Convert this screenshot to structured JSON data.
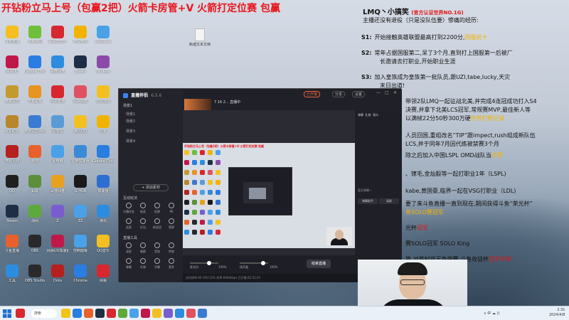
{
  "banner": "开钻粉立马上号（包赢2把）火箭卡房管+V  火箭打定位赛 包赢",
  "desktop_icons": [
    {
      "label": "斗鱼直播",
      "color": "#f4c021"
    },
    {
      "label": "斗鱼伴侣",
      "color": "#6fbf3a"
    },
    {
      "label": "网易云音乐",
      "color": "#d8272f"
    },
    {
      "label": "哔哩哔哩",
      "color": "#f0b400"
    },
    {
      "label": "WeGame",
      "color": "#4aa1e8"
    },
    {
      "label": "网易UU",
      "color": "#c1184a"
    },
    {
      "label": "Google Chrome",
      "color": "#2a7de1"
    },
    {
      "label": "百度网盘",
      "color": "#2c8de0"
    },
    {
      "label": "Steam",
      "color": "#1e2f45"
    },
    {
      "label": "WinRAR",
      "color": "#8c4aa8"
    },
    {
      "label": "英雄联盟",
      "color": "#c29a2d"
    },
    {
      "label": "斗鱼鲨鱼",
      "color": "#e89420"
    },
    {
      "label": "网易有道",
      "color": "#d8272f"
    },
    {
      "label": "网易邮箱",
      "color": "#e05263"
    },
    {
      "label": "游戏加速",
      "color": "#f4c021"
    },
    {
      "label": "LOL助手",
      "color": "#b8862b"
    },
    {
      "label": "英雄联盟WeGame版",
      "color": "#3b7bd1"
    },
    {
      "label": "回收站",
      "color": "#5a9bd5"
    },
    {
      "label": "腾讯QQ",
      "color": "#f4c021"
    },
    {
      "label": "斗鱼",
      "color": "#f0b400"
    },
    {
      "label": "穿越火线",
      "color": "#b5201e"
    },
    {
      "label": "傲游",
      "color": "#e8612c"
    },
    {
      "label": "此电脑",
      "color": "#4aa1e8"
    },
    {
      "label": "雷神加速器",
      "color": "#3a8ad6"
    },
    {
      "label": "Google Chrome",
      "color": "#2a7de1"
    },
    {
      "label": "QQ",
      "color": "#1f1f1f"
    },
    {
      "label": "蚂蚁",
      "color": "#5b8f3a"
    },
    {
      "label": "百度网盘",
      "color": "#e8a01f"
    },
    {
      "label": "G HUB",
      "color": "#1a1a1a"
    },
    {
      "label": "加速器",
      "color": "#2c6fd1"
    },
    {
      "label": "Steam",
      "color": "#1e2f45"
    },
    {
      "label": "战网",
      "color": "#5ea83c"
    },
    {
      "label": "Z",
      "color": "#7a5cd1"
    },
    {
      "label": "ZZ",
      "color": "#4aa1e8"
    },
    {
      "label": "通讯",
      "color": "#2c8de0"
    },
    {
      "label": "斗鱼直播",
      "color": "#e8612c"
    },
    {
      "label": "OBS",
      "color": "#2a2a2a"
    },
    {
      "label": "网易UU加速器",
      "color": "#c1184a"
    },
    {
      "label": "控制面板",
      "color": "#4aa1e8"
    },
    {
      "label": "QQ音乐",
      "color": "#f4c021"
    },
    {
      "label": "工具",
      "color": "#2c8de0"
    },
    {
      "label": "OBS Studio",
      "color": "#2a2a2a"
    },
    {
      "label": "Dota",
      "color": "#b5201e"
    },
    {
      "label": "Chrome",
      "color": "#2a7de1"
    },
    {
      "label": "网易",
      "color": "#d8272f"
    }
  ],
  "file_icon_label": "新建文本文档",
  "overlay": {
    "name": "LMQ丶小搞笑",
    "badge": "(官方认证世界NO.1G)",
    "subtitle": "主播还没有退役（只是没队伍要）惨痛的经历:",
    "lines": [
      {
        "num": "S1:",
        "text": "开始接触英雄联盟最高打到2200分,",
        "extra": "国服前十",
        "extra_color": "gold"
      },
      {
        "num": "S2:",
        "text": "常年占据国服第二,呆了3个月,直到打上国服第一后被厂",
        "extra": "",
        "extra_color": ""
      },
      {
        "num": "",
        "text": "长邀请去打职业,开始职业生涯",
        "extra": "",
        "extra_color": ""
      },
      {
        "num": "S3:",
        "text": "加入皇族成为皇族第一批队员,跟UZI,tabe,lucky,天灾",
        "extra": "",
        "extra_color": ""
      },
      {
        "num": "",
        "text": "末日出道!",
        "extra": "",
        "extra_color": ""
      },
      {
        "num": "",
        "text": "带领2队LMQ一起征战北美,并完成4连冠成功打入S4",
        "extra": "",
        "extra_color": ""
      },
      {
        "num": "",
        "text": "决赛,并拿下北美LCS冠军,常规赛MVP,最佳新人等",
        "extra": "",
        "extra_color": ""
      },
      {
        "num": "",
        "text": "以满帧22分50秒300万硬",
        "extra": "世界打野记录",
        "extra_color": "gold"
      },
      {
        "num": "",
        "text": "",
        "extra": "",
        "extra_color": ""
      },
      {
        "num": "",
        "text": "人员回国,重组改名“TIP”跟impect,rush组成新队伍",
        "extra": "",
        "extra_color": ""
      },
      {
        "num": "",
        "text": "LCS,并于同年7月因代练被禁赛3个月",
        "extra": "",
        "extra_color": ""
      },
      {
        "num": "",
        "text": "除之后加入中国LSPL OMD战队当",
        "extra": "打野",
        "extra_color": "gold"
      },
      {
        "num": "",
        "text": "",
        "extra": "",
        "extra_color": ""
      },
      {
        "num": "",
        "text": "、镓毛,金灿毅等一起打职业1年（LSPL)",
        "extra": "",
        "extra_color": ""
      },
      {
        "num": "",
        "text": "kabe,黄国豪,临界一起在VSG打职业（LDL)",
        "extra": "",
        "extra_color": ""
      },
      {
        "num": "",
        "text": "要了来斗鱼直播一直到现在,期间获得斗鱼“荣光杯”",
        "extra": "",
        "extra_color": ""
      },
      {
        "num": "",
        "text": "",
        "extra": "单SOLO赛冠军",
        "extra_color": "gold"
      },
      {
        "num": "",
        "text": "光杯",
        "extra": "冠军",
        "extra_color": "red"
      },
      {
        "num": "",
        "text": "赛SOLO冠军      SOLO King",
        "extra": "",
        "extra_color": ""
      },
      {
        "num": "",
        "text": "路,对苍村双王争夺赛,斗鱼收徒杯",
        "extra": "冠军中单",
        "extra_color": "red"
      }
    ]
  },
  "app": {
    "brand": "直播伴侣",
    "version": "6.5.6",
    "sections": [
      {
        "label": "场景1",
        "items": [
          "场景1",
          "场景2",
          "场景3",
          "场景4"
        ]
      }
    ],
    "add_source_button": "+ 添加素材",
    "tools_title": "互动玩法",
    "tools": [
      "主播任务",
      "抽奖",
      "投票",
      "PK",
      "连麦",
      "红包",
      "粉丝团",
      "管理"
    ],
    "more_title": "直播工具",
    "more_tools": [
      "录屏",
      "美颜",
      "音效",
      "特效",
      "弹幕",
      "礼物",
      "字幕",
      "更多"
    ],
    "live_title": "7 16 2... 直播中",
    "top_buttons": [
      "已开播",
      "分享",
      "设置"
    ],
    "window_controls": [
      "—",
      "□",
      "✕"
    ],
    "preview_banner": "开钻粉立马上号（包赢2把）火箭卡房管+V  火箭打定位赛 包赢",
    "bottom_labels": [
      "麦克风",
      "100%",
      "扬声器",
      "100%"
    ],
    "live_button": "结束直播",
    "status_text": "实时帧率:60  CPU:12%  码率:6000kbps  已开播 02:31:45",
    "chat_tabs": [
      "弹幕",
      "礼物",
      "观众"
    ],
    "chat_empty": "暂无弹幕~",
    "chat_buttons": [
      "弹幕助手",
      "清屏"
    ]
  },
  "taskbar": {
    "search_placeholder": "搜索",
    "apps": [
      "#f0c419",
      "#2a7de1",
      "#e8612c",
      "#1e2f45",
      "#d8272f",
      "#5ea83c",
      "#4aa1e8",
      "#c1184a",
      "#f4c021",
      "#7a5cd1",
      "#2c8de0",
      "#e05263",
      "#3b7bd1"
    ],
    "tray": "∧ 中 ☁ ))",
    "time": "2:31",
    "date": "2024/4/8"
  }
}
